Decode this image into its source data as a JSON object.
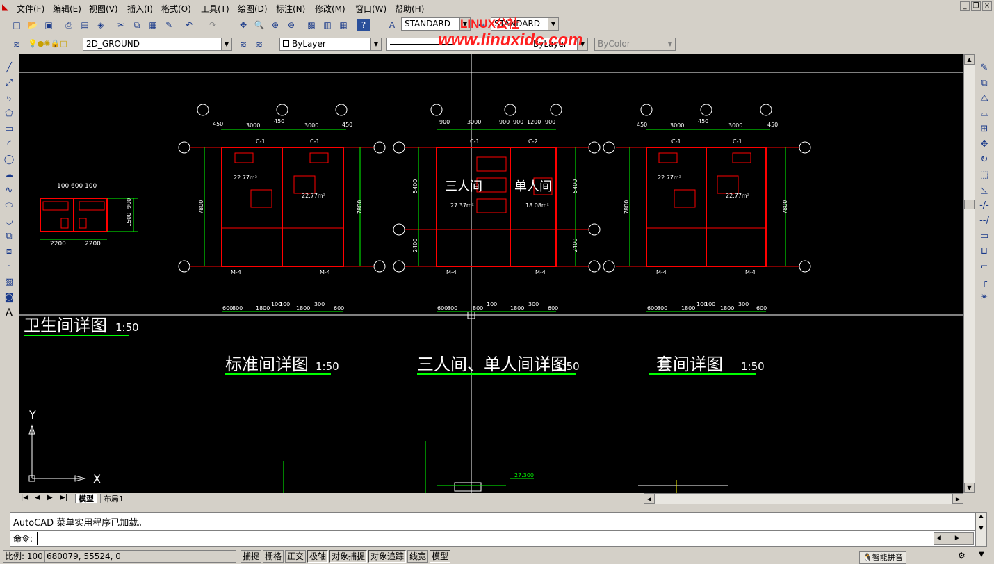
{
  "menu": [
    "文件(F)",
    "编辑(E)",
    "视图(V)",
    "插入(I)",
    "格式(O)",
    "工具(T)",
    "绘图(D)",
    "标注(N)",
    "修改(M)",
    "窗口(W)",
    "帮助(H)"
  ],
  "styles": {
    "text_style": "STANDARD",
    "dim_style": "STANDARD"
  },
  "layers": {
    "current": "2D_GROUND",
    "color": "ByLayer",
    "linetype": "ByLayer",
    "plotstyle": "ByColor"
  },
  "watermark": {
    "brand": "LINUX公社",
    "url": "www.linuxidc.com"
  },
  "drawing": {
    "small_plan": {
      "dims_top": "100 600 100",
      "dims_bottom_a": "2200",
      "dims_bottom_b": "2200",
      "dim_right_a": "900",
      "dim_right_b": "1500"
    },
    "standard_plan": {
      "top_a": "450",
      "top_b": "3000",
      "top_c": "450",
      "top_d": "3000",
      "top_e": "450",
      "area_a": "22.77m²",
      "area_b": "22.77m²",
      "door_a": "M-4",
      "door_b": "M-4",
      "win_a": "C-1",
      "win_b": "C-1",
      "depth": "7800"
    },
    "triple_plan": {
      "top_a": "900",
      "top_b": "3000",
      "top_c": "900",
      "top_d": "900",
      "top_e": "1200",
      "top_f": "900",
      "room_a": "三人间",
      "room_b": "单人间",
      "area_a": "27.37m²",
      "area_b": "18.08m²",
      "depth_a": "5400",
      "depth_b": "2400",
      "win_a": "C-1",
      "win_b": "C-2",
      "door_a": "M-4",
      "door_b": "M-4"
    },
    "suite_plan": {
      "top_a": "450",
      "top_b": "3000",
      "top_c": "450",
      "top_d": "3000",
      "top_e": "450",
      "area_a": "22.77m²",
      "area_b": "22.77m²",
      "win_a": "C-1",
      "win_b": "C-1",
      "door_a": "M-4",
      "door_b": "M-4",
      "depth": "7800"
    },
    "bottom_dims": [
      "600",
      "800",
      "1800",
      "100",
      "100",
      "1800",
      "300",
      "600"
    ],
    "bottom_mid": "800",
    "caption_bath": "卫生间详图",
    "caption_bath_scale": "1:50",
    "caption_standard": "标准间详图",
    "caption_standard_scale": "1:50",
    "caption_triple": "三人间、单人间详图",
    "caption_triple_scale": "1:50",
    "caption_suite": "套间详图",
    "caption_suite_scale": "1:50",
    "elev_label": "27.300",
    "axis_x": "X",
    "axis_y": "Y"
  },
  "tabs": [
    "模型",
    "布局1"
  ],
  "command": {
    "history": "AutoCAD 菜单实用程序已加载。",
    "prompt": "命令:"
  },
  "status": {
    "scale": "比例: 100",
    "coords": "680079, 55524, 0",
    "buttons": [
      "捕捉",
      "栅格",
      "正交",
      "极轴",
      "对象捕捉",
      "对象追踪",
      "线宽",
      "模型"
    ]
  },
  "tray": {
    "ime": "智能拼音"
  },
  "colors": {
    "canvas": "#000000",
    "wall": "#ff0000",
    "dim": "#00ff00",
    "text": "#ffffff",
    "axis": "#ffffff"
  }
}
